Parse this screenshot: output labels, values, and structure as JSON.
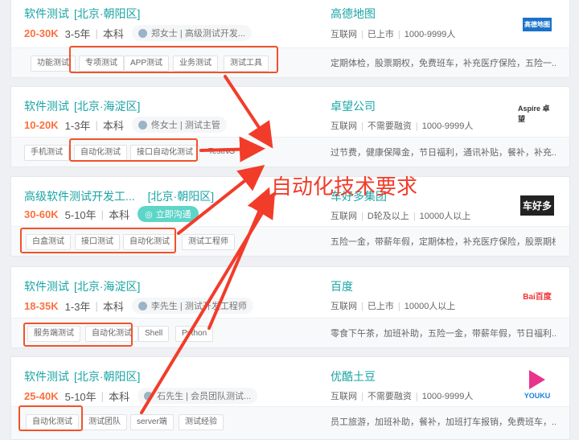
{
  "jobs": [
    {
      "title": "软件测试",
      "location": "[北京·朝阳区]",
      "salary": "20-30K",
      "experience": "3-5年",
      "education": "本科",
      "recruiter": "郑女士 | 高级测试开发...",
      "tags": [
        "功能测试",
        "专项测试",
        "APP测试",
        "业务测试",
        "测试工具"
      ],
      "company": "高德地图",
      "company_meta": [
        "互联网",
        "已上市",
        "1000-9999人"
      ],
      "welfare": "定期体检，股票期权，免费班车，补充医疗保险，五险一...",
      "logo_text": "高德地图"
    },
    {
      "title": "软件测试",
      "location": "[北京·海淀区]",
      "salary": "10-20K",
      "experience": "1-3年",
      "education": "本科",
      "recruiter": "佟女士 | 测试主管",
      "tags": [
        "手机测试",
        "自动化测试",
        "接口自动化测试",
        "TestNG"
      ],
      "company": "卓望公司",
      "company_meta": [
        "互联网",
        "不需要融资",
        "1000-9999人"
      ],
      "welfare": "过节费，健康保障金，节日福利，通讯补贴，餐补，补充...",
      "logo_text": "Aspire 卓望"
    },
    {
      "title": "高级软件测试开发工...",
      "location": "[北京·朝阳区]",
      "salary": "30-60K",
      "experience": "5-10年",
      "education": "本科",
      "chat_label": "立即沟通",
      "tags": [
        "白盒测试",
        "接口测试",
        "自动化测试",
        "测试工程师"
      ],
      "company": "车好多集团",
      "company_meta": [
        "互联网",
        "D轮及以上",
        "10000人以上"
      ],
      "welfare": "五险一金，带薪年假，定期体检，补充医疗保险，股票期权",
      "logo_text": "车好多"
    },
    {
      "title": "软件测试",
      "location": "[北京·海淀区]",
      "salary": "18-35K",
      "experience": "1-3年",
      "education": "本科",
      "recruiter": "李先生 | 测试开发工程师",
      "tags": [
        "服务端测试",
        "自动化测试",
        "Shell",
        "Python"
      ],
      "company": "百度",
      "company_meta": [
        "互联网",
        "已上市",
        "10000人以上"
      ],
      "welfare": "零食下午茶，加班补助，五险一金，带薪年假，节日福利...",
      "logo_text": "Bai百度"
    },
    {
      "title": "软件测试",
      "location": "[北京·朝阳区]",
      "salary": "25-40K",
      "experience": "5-10年",
      "education": "本科",
      "recruiter": "石先生 | 会员团队测试...",
      "tags": [
        "自动化测试",
        "测试团队",
        "server端",
        "测试经验"
      ],
      "company": "优酷土豆",
      "company_meta": [
        "互联网",
        "不需要融资",
        "1000-9999人"
      ],
      "welfare": "员工旅游，加班补助，餐补，加班打车报销，免费班车，...",
      "logo_text": "YOUKU"
    }
  ],
  "annotation": "自动化技术要求",
  "colors": {
    "accent": "#1aa4a4",
    "salary": "#fc703e",
    "highlight": "#f0532b"
  }
}
